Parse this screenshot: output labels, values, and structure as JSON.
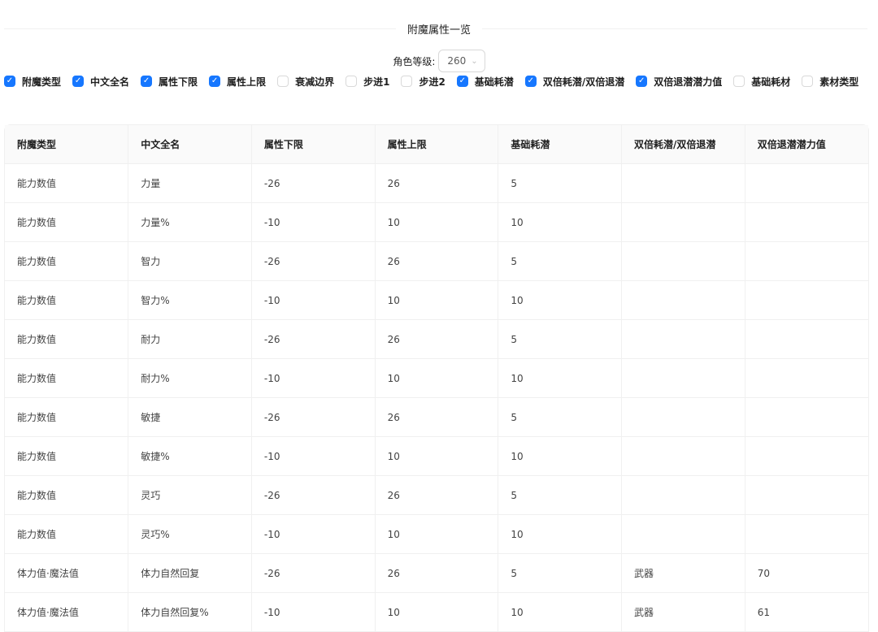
{
  "title": "附魔属性一览",
  "level": {
    "label": "角色等级:",
    "value": "260"
  },
  "accent": "#1677ff",
  "checkboxes": [
    {
      "label": "附魔类型",
      "checked": true
    },
    {
      "label": "中文全名",
      "checked": true
    },
    {
      "label": "属性下限",
      "checked": true
    },
    {
      "label": "属性上限",
      "checked": true
    },
    {
      "label": "衰减边界",
      "checked": false
    },
    {
      "label": "步进1",
      "checked": false
    },
    {
      "label": "步进2",
      "checked": false
    },
    {
      "label": "基础耗潜",
      "checked": true
    },
    {
      "label": "双倍耗潜/双倍退潜",
      "checked": true
    },
    {
      "label": "双倍退潜潜力值",
      "checked": true
    },
    {
      "label": "基础耗材",
      "checked": false
    },
    {
      "label": "素材类型",
      "checked": false
    }
  ],
  "table": {
    "columns": [
      "附魔类型",
      "中文全名",
      "属性下限",
      "属性上限",
      "基础耗潜",
      "双倍耗潜/双倍退潜",
      "双倍退潜潜力值"
    ],
    "rows": [
      [
        "能力数值",
        "力量",
        "-26",
        "26",
        "5",
        "",
        ""
      ],
      [
        "能力数值",
        "力量%",
        "-10",
        "10",
        "10",
        "",
        ""
      ],
      [
        "能力数值",
        "智力",
        "-26",
        "26",
        "5",
        "",
        ""
      ],
      [
        "能力数值",
        "智力%",
        "-10",
        "10",
        "10",
        "",
        ""
      ],
      [
        "能力数值",
        "耐力",
        "-26",
        "26",
        "5",
        "",
        ""
      ],
      [
        "能力数值",
        "耐力%",
        "-10",
        "10",
        "10",
        "",
        ""
      ],
      [
        "能力数值",
        "敏捷",
        "-26",
        "26",
        "5",
        "",
        ""
      ],
      [
        "能力数值",
        "敏捷%",
        "-10",
        "10",
        "10",
        "",
        ""
      ],
      [
        "能力数值",
        "灵巧",
        "-26",
        "26",
        "5",
        "",
        ""
      ],
      [
        "能力数值",
        "灵巧%",
        "-10",
        "10",
        "10",
        "",
        ""
      ],
      [
        "体力值·魔法值",
        "体力自然回复",
        "-26",
        "26",
        "5",
        "武器",
        "70"
      ],
      [
        "体力值·魔法值",
        "体力自然回复%",
        "-10",
        "10",
        "10",
        "武器",
        "61"
      ]
    ]
  }
}
